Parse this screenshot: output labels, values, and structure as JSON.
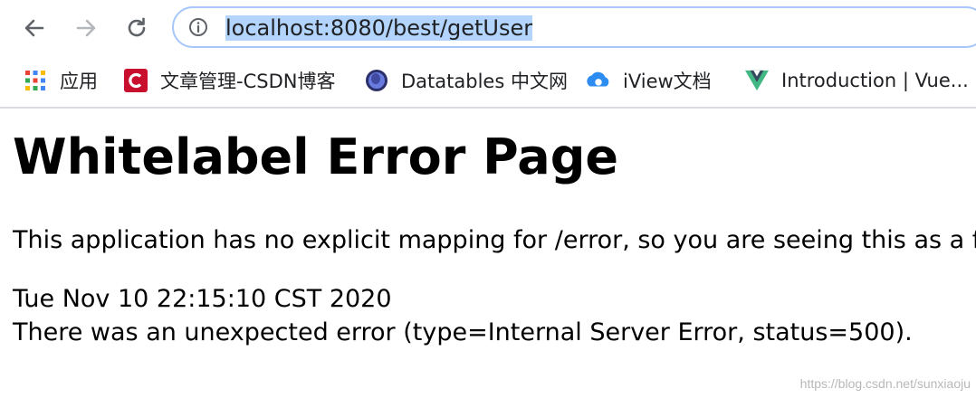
{
  "browser": {
    "address_bar": {
      "url": "localhost:8080/best/getUser"
    },
    "nav_icons": [
      "back-arrow-icon",
      "forward-arrow-icon",
      "reload-icon",
      "info-icon"
    ],
    "bookmarks": [
      {
        "label": "应用",
        "icon": "apps-grid-icon"
      },
      {
        "label": "文章管理-CSDN博客",
        "icon": "csdn-logo-icon",
        "color": "#c8102e"
      },
      {
        "label": "Datatables 中文网",
        "icon": "datatables-logo-icon",
        "color": "#3f4aa0"
      },
      {
        "label": "iView文档",
        "icon": "iview-logo-icon",
        "color": "#2d8cf0"
      },
      {
        "label": "Introduction | Vue...",
        "icon": "vue-logo-icon",
        "color": "#41b883"
      }
    ],
    "colors": {
      "selection_highlight": "#b3d4fc",
      "omnibox_border": "#a8c7fa"
    }
  },
  "page": {
    "title": "Whitelabel Error Page",
    "message": "This application has no explicit mapping for /error, so you are seeing this as a fa",
    "timestamp": "Tue Nov 10 22:15:10 CST 2020",
    "error": "There was an unexpected error (type=Internal Server Error, status=500)."
  },
  "watermark": "https://blog.csdn.net/sunxiaoju"
}
